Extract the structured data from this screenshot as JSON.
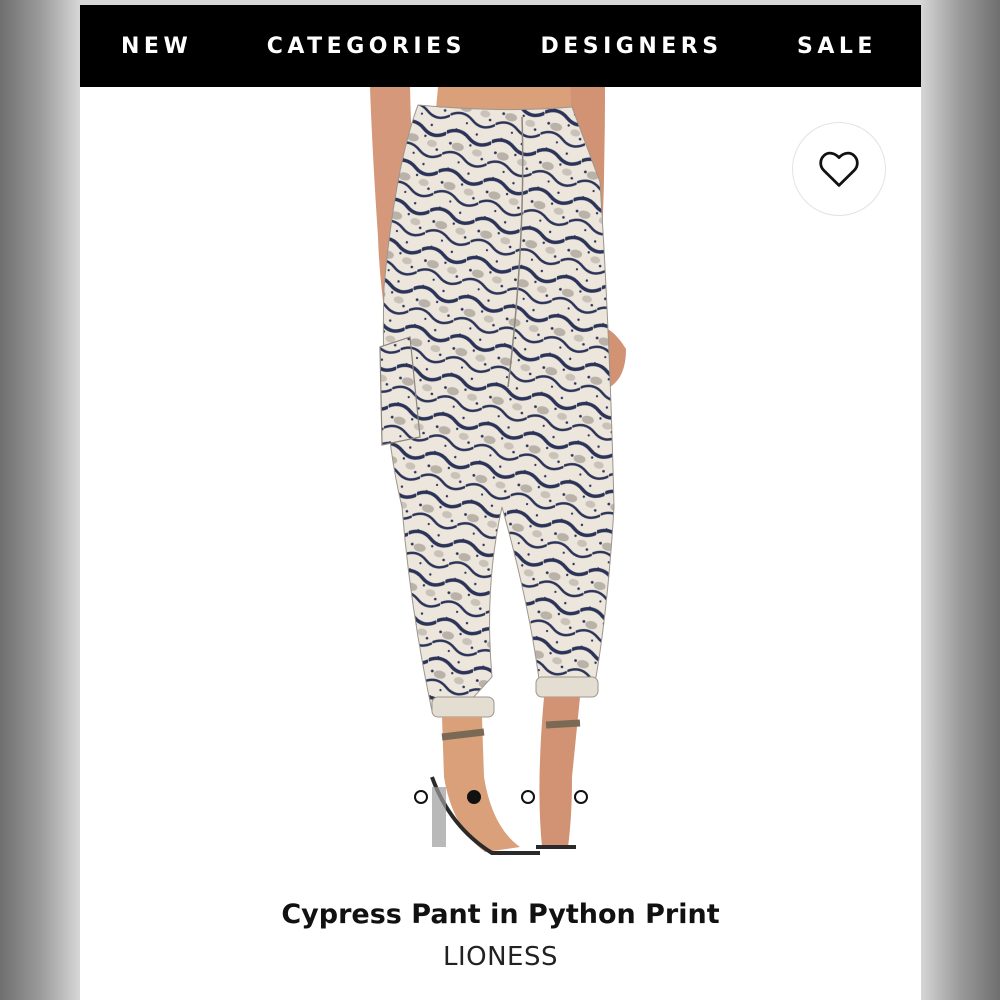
{
  "nav": {
    "items": [
      {
        "label": "NEW"
      },
      {
        "label": "CATEGORIES"
      },
      {
        "label": "DESIGNERS"
      },
      {
        "label": "SALE"
      }
    ]
  },
  "product": {
    "image_alt": "Cypress Pant in Python Print",
    "title": "Cypress Pant in Python Print",
    "brand": "LIONESS",
    "carousel": {
      "total": 4,
      "active_index": 2
    }
  },
  "icons": {
    "favorite": "heart-outline-icon"
  },
  "colors": {
    "nav_background": "#000000",
    "nav_text": "#ffffff",
    "print_navy": "#2b3358",
    "print_cream": "#ece6dc",
    "skin": "#d9a07a"
  }
}
